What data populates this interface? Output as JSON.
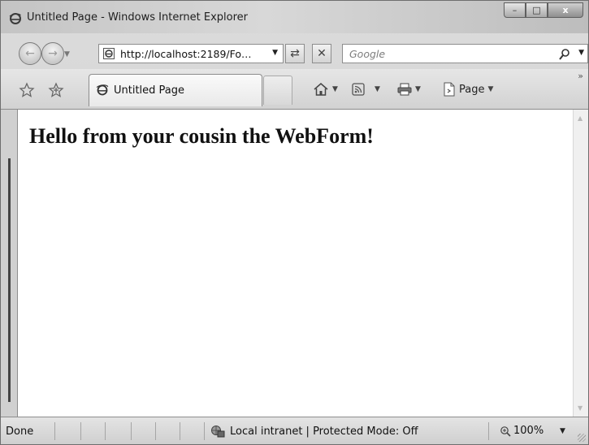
{
  "window": {
    "title": "Untitled Page - Windows Internet Explorer",
    "caption_buttons": {
      "minimize": "–",
      "maximize": "□",
      "close": "x"
    }
  },
  "navigation": {
    "back_icon": "back-arrow-icon",
    "forward_icon": "forward-arrow-icon",
    "address": "http://localhost:2189/Fo…",
    "search_placeholder": "Google"
  },
  "command_bar": {
    "tab_label": "Untitled Page",
    "page_menu_label": "Page",
    "icons": [
      "favorites-star-icon",
      "add-favorites-icon",
      "home-icon",
      "feeds-icon",
      "print-icon",
      "page-icon"
    ]
  },
  "content": {
    "heading": "Hello from your cousin the WebForm!"
  },
  "status_bar": {
    "status": "Done",
    "zone": "Local intranet | Protected Mode: Off",
    "zoom": "100%"
  }
}
